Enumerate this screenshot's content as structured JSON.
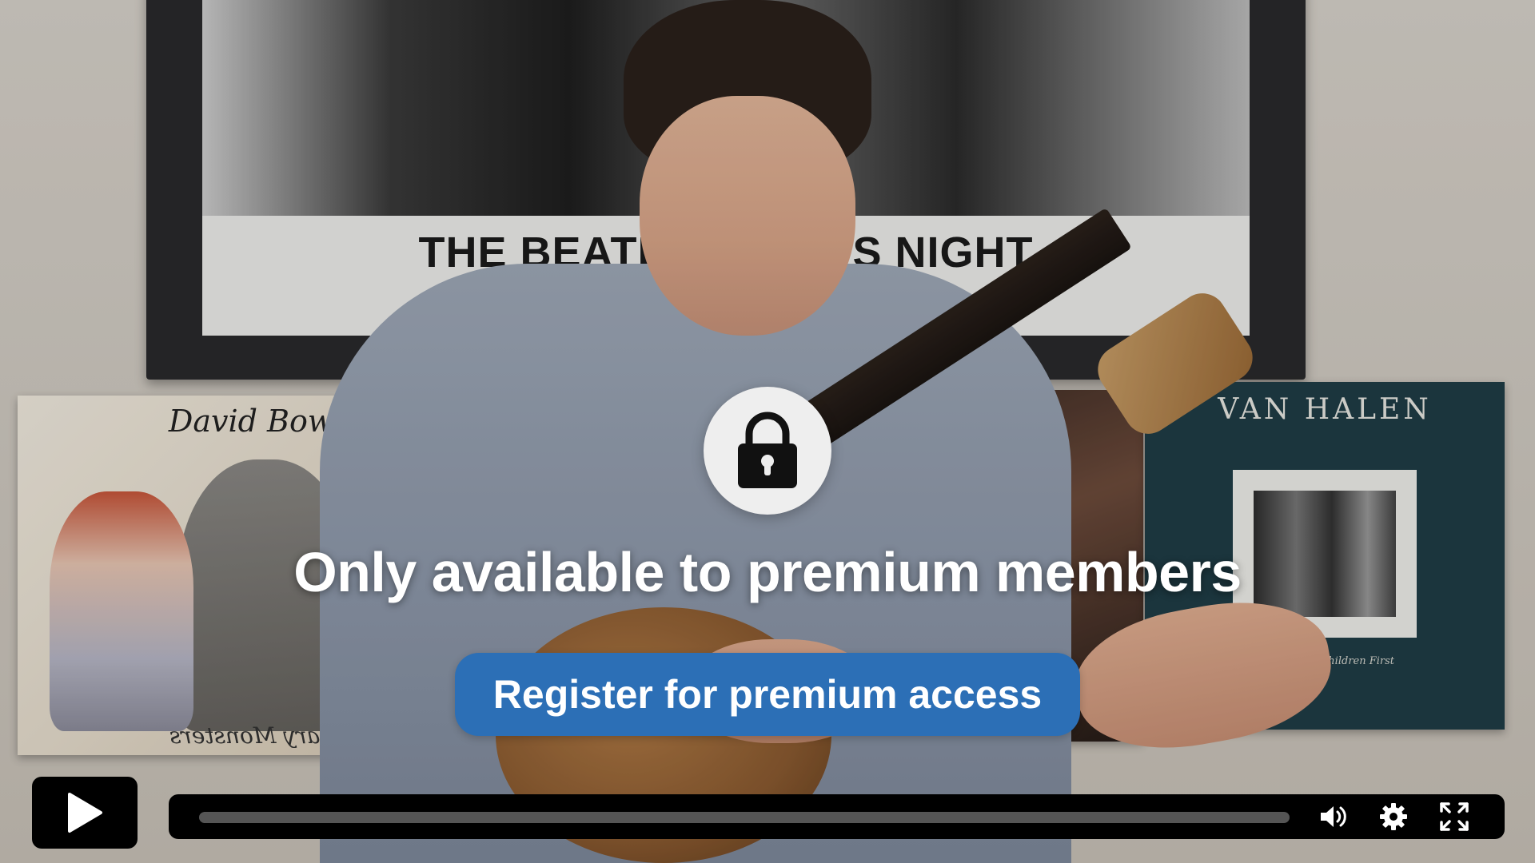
{
  "video": {
    "poster_caption": "THE BEATLE        D DAY'S NIGHT",
    "album_left_title": "David Bowie",
    "album_left_foot": "Scary Monsters",
    "album_right_title": "VAN HALEN",
    "album_right_subtitle": "Women and Children First"
  },
  "overlay": {
    "lock_icon": "lock-icon",
    "message": "Only available to premium members",
    "register_label": "Register for premium access",
    "accent_color": "#2c6fb6"
  },
  "controls": {
    "play_icon": "play-icon",
    "progress_fraction": 0.0,
    "volume_icon": "volume-icon",
    "settings_icon": "gear-icon",
    "fullscreen_icon": "fullscreen-icon"
  }
}
